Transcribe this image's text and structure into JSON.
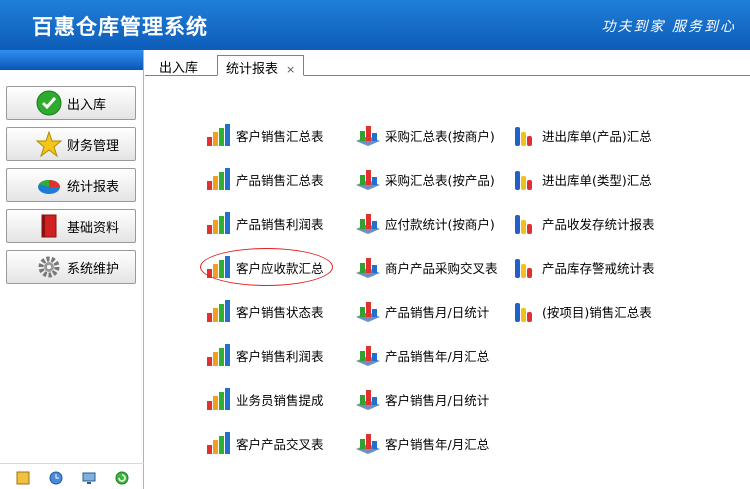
{
  "app": {
    "title": "百惠仓库管理系统",
    "slogan": "功夫到家 服务到心"
  },
  "sidebar": {
    "items": [
      {
        "label": "出入库",
        "icon": "check-icon"
      },
      {
        "label": "财务管理",
        "icon": "star-icon"
      },
      {
        "label": "统计报表",
        "icon": "pie-chart-icon"
      },
      {
        "label": "基础资料",
        "icon": "book-icon"
      },
      {
        "label": "系统维护",
        "icon": "gear-icon"
      }
    ]
  },
  "tabs": [
    {
      "label": "出入库"
    },
    {
      "label": "统计报表",
      "close": "×"
    }
  ],
  "reports": {
    "col1": [
      "客户销售汇总表",
      "产品销售汇总表",
      "产品销售利润表",
      "客户应收款汇总",
      "客户销售状态表",
      "客户销售利润表",
      "业务员销售提成",
      "客户产品交叉表"
    ],
    "col2": [
      "采购汇总表(按商户)",
      "采购汇总表(按产品)",
      "应付款统计(按商户)",
      "商户产品采购交叉表",
      "产品销售月/日统计",
      "产品销售年/月汇总",
      "客户销售月/日统计",
      "客户销售年/月汇总"
    ],
    "col3": [
      "进出库单(产品)汇总",
      "进出库单(类型)汇总",
      "产品收发存统计报表",
      "产品库存警戒统计表",
      "(按项目)销售汇总表"
    ]
  },
  "colors": {
    "header": "#1565c8",
    "highlight_circle": "#e02020"
  }
}
